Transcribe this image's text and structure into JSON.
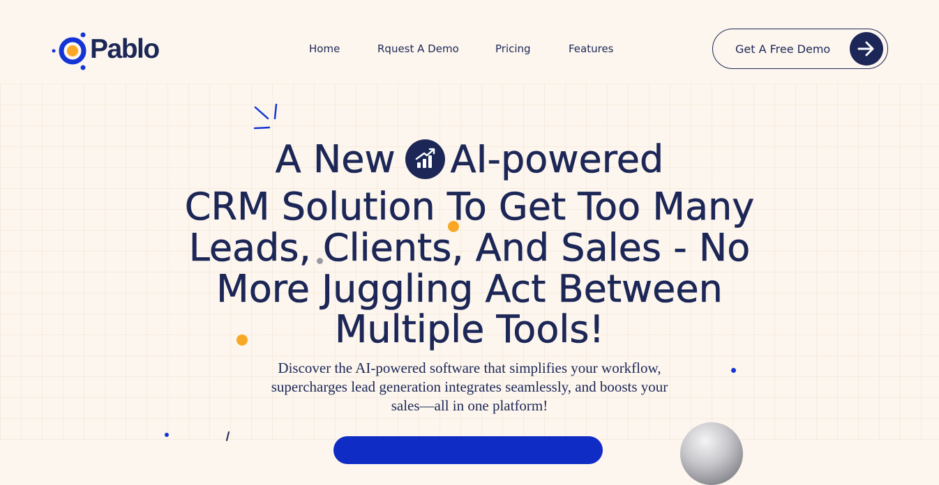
{
  "brand": {
    "name": "Pablo",
    "colors": {
      "primary": "#1c2757",
      "accent_blue": "#0f2cc4",
      "accent_orange": "#f9a825",
      "background": "#fdf6ee"
    }
  },
  "nav": {
    "items": [
      {
        "label": "Home"
      },
      {
        "label": "Rquest A Demo"
      },
      {
        "label": "Pricing"
      },
      {
        "label": "Features"
      }
    ]
  },
  "header_cta": {
    "label": "Get A Free Demo",
    "icon": "arrow-right-icon"
  },
  "hero": {
    "title_line1_prefix": "A New",
    "title_badge_icon": "bar-chart-trending-up-icon",
    "title_line1_suffix": "AI-powered",
    "title_line2": "CRM Solution  To Get Too Many",
    "title_line3": "Leads, Clients, And Sales - No",
    "title_line4": "More Juggling Act Between",
    "title_line5": "Multiple Tools!",
    "subtitle_line1": "Discover the AI-powered software that simplifies your workflow,",
    "subtitle_line2": "supercharges lead generation integrates seamlessly, and boosts your",
    "subtitle_line3": "sales—all in one platform!"
  }
}
